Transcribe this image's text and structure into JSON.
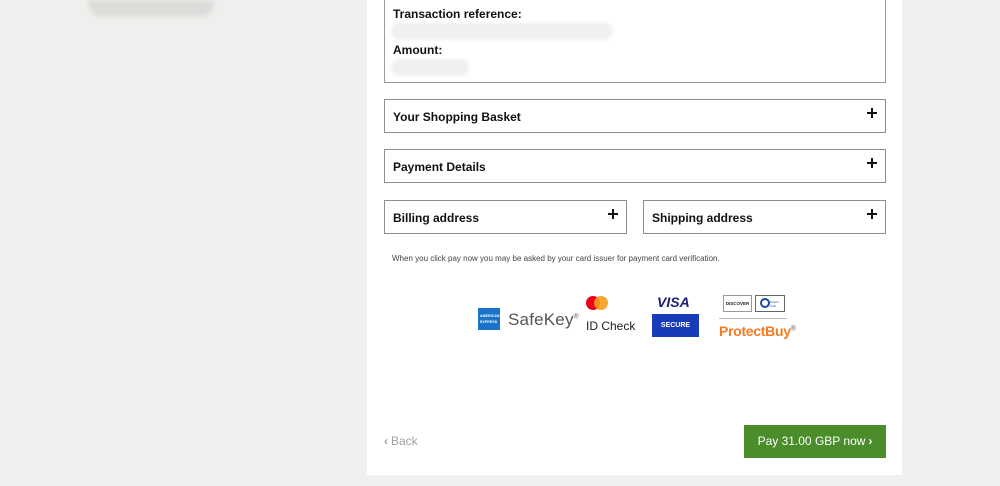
{
  "summary": {
    "reference_label": "Transaction reference:",
    "amount_label": "Amount:"
  },
  "sections": {
    "basket": "Your Shopping Basket",
    "payment": "Payment Details",
    "billing": "Billing address",
    "shipping": "Shipping address"
  },
  "notice": "When you click pay now you may be asked by your card issuer for payment card verification.",
  "logos": {
    "amex_line1": "AMERICAN",
    "amex_line2": "EXPRESS",
    "safekey": "SafeKey",
    "safekey_mark": "®",
    "idcheck": "ID Check",
    "visa": "VISA",
    "visa_secure": "SECURE",
    "discover": "DISCOVER",
    "diners": "Diners Club",
    "protectbuy": "ProtectBuy",
    "protectbuy_mark": "®"
  },
  "actions": {
    "back_label": "Back",
    "pay_label": "Pay 31.00 GBP now"
  },
  "colors": {
    "pay_button": "#4a8d2a",
    "background": "#efefed"
  }
}
